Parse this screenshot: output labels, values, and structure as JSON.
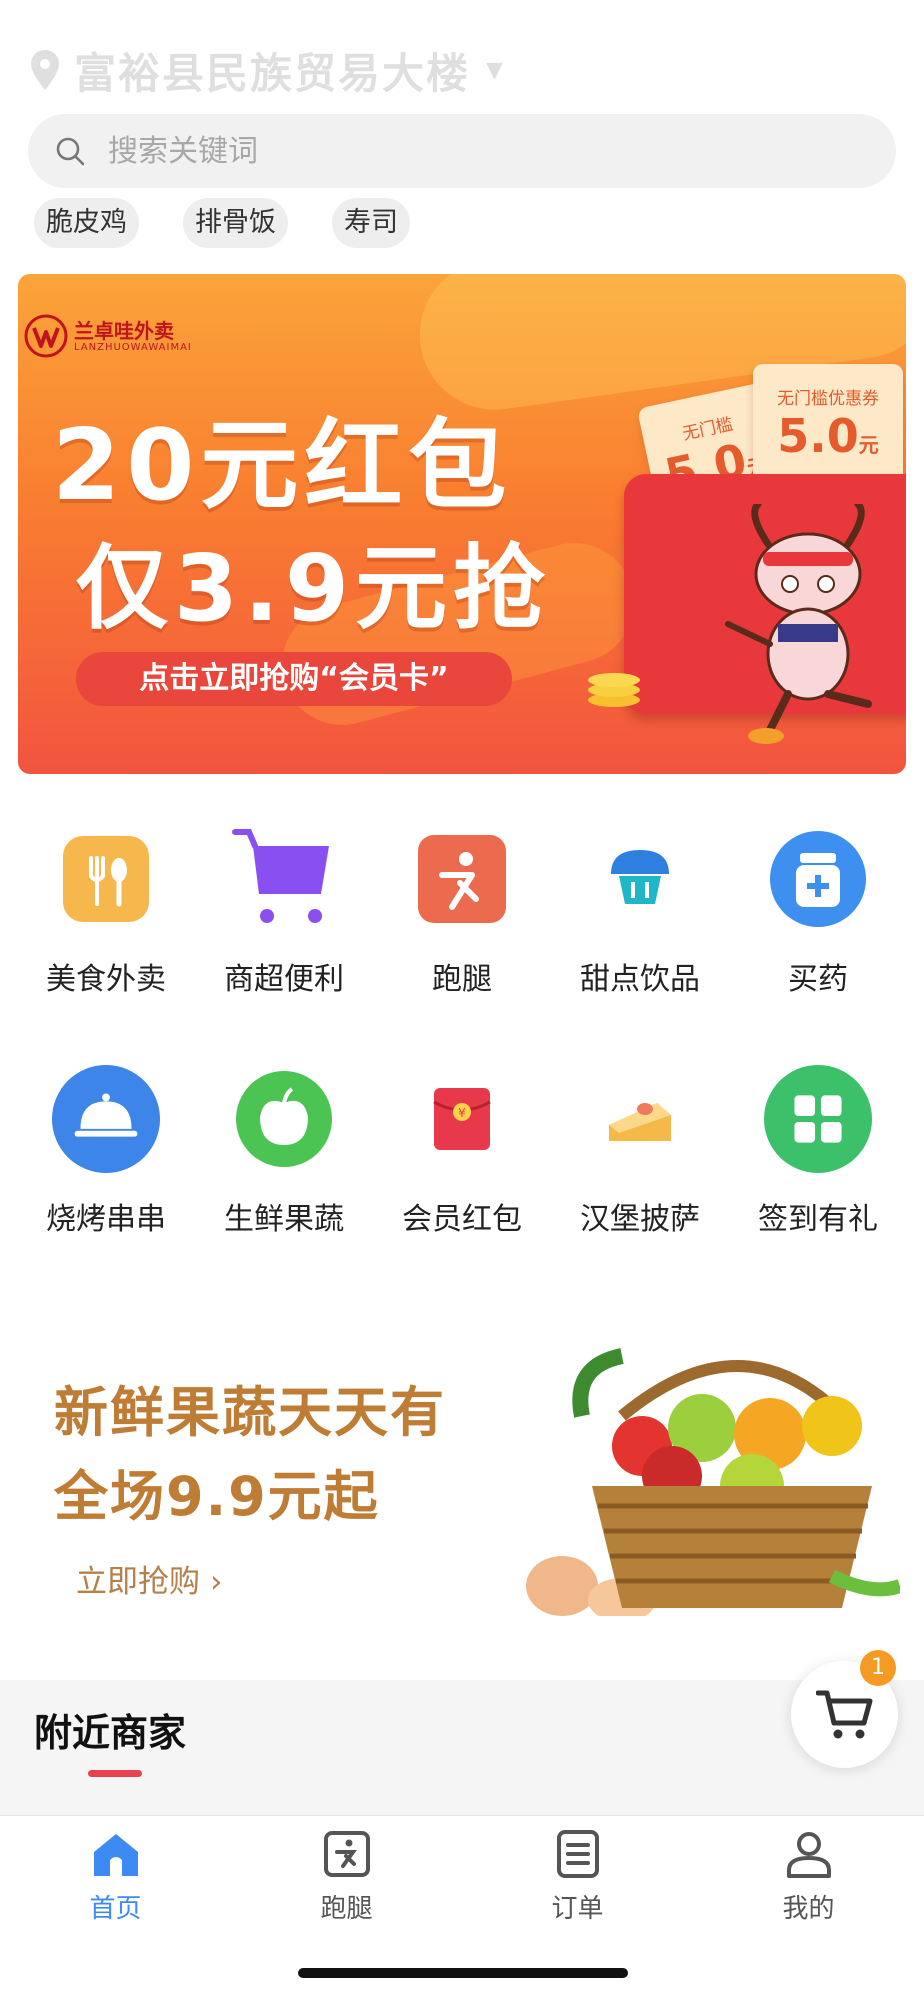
{
  "location": {
    "address": "富裕县民族贸易大楼"
  },
  "search": {
    "placeholder": "搜索关键词",
    "hot_tags": [
      "脆皮鸡",
      "排骨饭",
      "寿司"
    ]
  },
  "promo_banner": {
    "brand_cn": "兰卓哇外卖",
    "brand_en": "LANZHUOWAWAIMAI",
    "headline_1": "20元红包",
    "headline_2": "仅3.9元抢",
    "cta": "点击立即抢购“会员卡”",
    "coupon_left": {
      "title": "无门槛",
      "amount": "5.0",
      "unit": "元"
    },
    "coupon_right": {
      "title": "无门槛优惠券",
      "amount": "5.0",
      "unit": "元"
    }
  },
  "categories": [
    {
      "label": "美食外卖",
      "icon": "fork-knife-icon",
      "color": "#f6b84c"
    },
    {
      "label": "商超便利",
      "icon": "shopping-cart-icon",
      "color": "#8a4ff0"
    },
    {
      "label": "跑腿",
      "icon": "runner-icon",
      "color": "#ec6b4e"
    },
    {
      "label": "甜点饮品",
      "icon": "cupcake-icon",
      "color": "#2f7fe0"
    },
    {
      "label": "买药",
      "icon": "medicine-bottle-icon",
      "color": "#3d8ff0"
    },
    {
      "label": "烧烤串串",
      "icon": "food-cloche-icon",
      "color": "#3d85e8"
    },
    {
      "label": "生鲜果蔬",
      "icon": "apple-icon",
      "color": "#4cc454"
    },
    {
      "label": "会员红包",
      "icon": "red-envelope-icon",
      "color": "#e8384c"
    },
    {
      "label": "汉堡披萨",
      "icon": "cake-slice-icon",
      "color": "#f5b94a"
    },
    {
      "label": "签到有礼",
      "icon": "grid-apps-icon",
      "color": "#3cc06a"
    }
  ],
  "fresh_banner": {
    "title_1": "新鲜果蔬天天有",
    "title_2": "全场9.9元起",
    "cta": "立即抢购",
    "cta_chevron": "›"
  },
  "nearby": {
    "title": "附近商家"
  },
  "cart": {
    "badge_count": "1"
  },
  "tabs": [
    {
      "label": "首页",
      "icon": "home-icon",
      "active": true
    },
    {
      "label": "跑腿",
      "icon": "errand-icon",
      "active": false
    },
    {
      "label": "订单",
      "icon": "order-list-icon",
      "active": false
    },
    {
      "label": "我的",
      "icon": "user-icon",
      "active": false
    }
  ],
  "colors": {
    "accent": "#3d8bf2",
    "banner_orange": "#f97e30",
    "badge": "#f59a23",
    "underline": "#e8424f"
  }
}
